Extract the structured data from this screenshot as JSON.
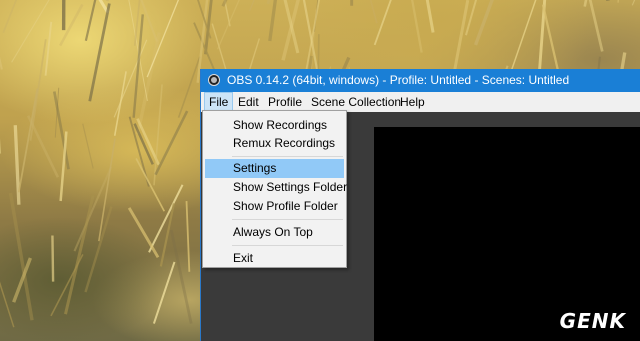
{
  "window": {
    "title": "OBS 0.14.2 (64bit, windows) - Profile: Untitled - Scenes: Untitled",
    "titlebar_color": "#1a7fd6",
    "icon": "obs-logo-icon"
  },
  "menubar": {
    "file": "File",
    "edit": "Edit",
    "profile": "Profile",
    "scene_collection": "Scene Collection",
    "help": "Help",
    "active": "File"
  },
  "file_menu": {
    "items": [
      "Show Recordings",
      "Remux Recordings",
      "Settings",
      "Show Settings Folder",
      "Show Profile Folder",
      "Always On Top",
      "Exit"
    ],
    "highlighted": "Settings",
    "highlight_color": "#91c9f7"
  },
  "watermark": {
    "text": "GENK"
  }
}
